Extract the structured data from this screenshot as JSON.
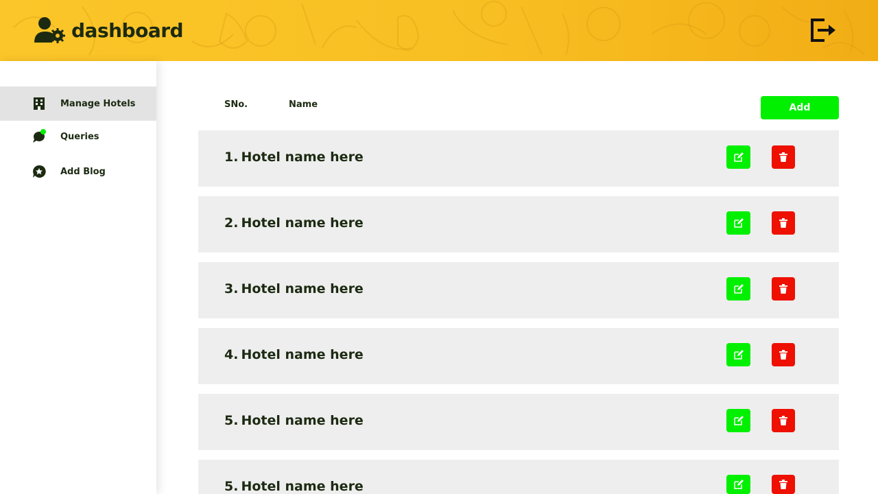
{
  "header": {
    "title": "dashboard",
    "brand_icon": "user-gear-icon",
    "logout_icon": "logout-icon",
    "background_color": "#f8bf22"
  },
  "sidebar": {
    "items": [
      {
        "label": "Manage Hotels",
        "icon": "hotel-icon",
        "active": true
      },
      {
        "label": "Queries",
        "icon": "chat-icon",
        "active": false
      },
      {
        "label": "Add Blog",
        "icon": "star-chat-icon",
        "active": false
      }
    ],
    "active_background": "#e3e3e3"
  },
  "table": {
    "columns": [
      "SNo.",
      "Name"
    ],
    "add_label": "Add",
    "rows": [
      {
        "num": "1.",
        "name": "Hotel name here"
      },
      {
        "num": "2.",
        "name": "Hotel name here"
      },
      {
        "num": "3.",
        "name": "Hotel name here"
      },
      {
        "num": "4.",
        "name": "Hotel name here"
      },
      {
        "num": "5.",
        "name": "Hotel name here"
      },
      {
        "num": "5.",
        "name": "Hotel name here"
      }
    ],
    "edit_icon": "edit-icon",
    "delete_icon": "trash-icon"
  },
  "colors": {
    "accent_green": "#00f000",
    "danger_red": "#ee1000",
    "text_dark": "#1c2a12",
    "row_background": "#eeeeee"
  }
}
